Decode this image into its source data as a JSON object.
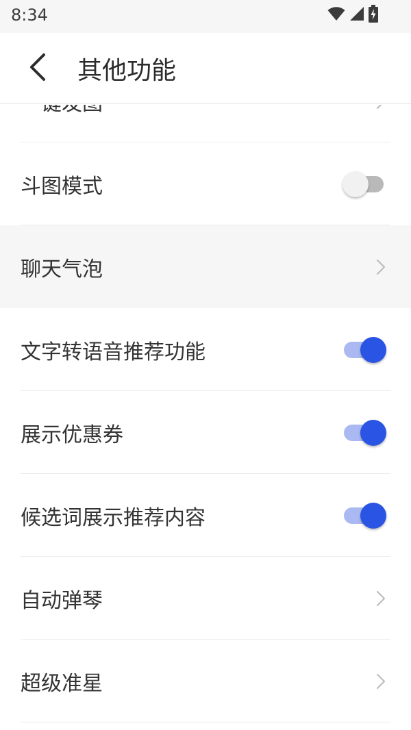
{
  "status_bar": {
    "time": "8:34",
    "icons": [
      "wifi-icon",
      "cellular-signal-icon",
      "battery-charging-icon"
    ]
  },
  "app_bar": {
    "back_icon": "back-arrow-icon",
    "title": "其他功能"
  },
  "colors": {
    "accent": "#2a54e3",
    "accent_track": "#aab9f1",
    "toggle_off_track": "#b9b9b9",
    "toggle_off_knob": "#f1f1f1",
    "highlight_row": "#f6f6f6"
  },
  "settings": [
    {
      "label": "一键发图",
      "control": "chevron"
    },
    {
      "label": "斗图模式",
      "control": "toggle",
      "on": false
    },
    {
      "label": "聊天气泡",
      "control": "chevron",
      "highlighted": true
    },
    {
      "label": "文字转语音推荐功能",
      "control": "toggle",
      "on": true
    },
    {
      "label": "展示优惠券",
      "control": "toggle",
      "on": true
    },
    {
      "label": "候选词展示推荐内容",
      "control": "toggle",
      "on": true
    },
    {
      "label": "自动弹琴",
      "control": "chevron"
    },
    {
      "label": "超级准星",
      "control": "chevron"
    }
  ]
}
